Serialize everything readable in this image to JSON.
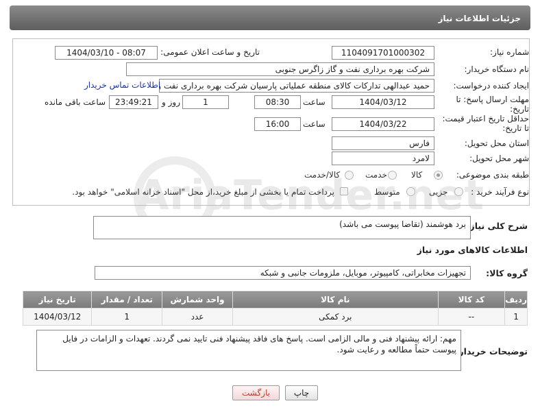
{
  "header": {
    "title": "جزئیات اطلاعات نیاز"
  },
  "watermark": {
    "text": "AriaTender.net"
  },
  "form": {
    "need_number_label": "شماره نیاز:",
    "need_number": "1104091701000302",
    "announce_label": "تاریخ و ساعت اعلان عمومی:",
    "announce_value": "1404/03/10 - 08:07",
    "buyer_org_label": "نام دستگاه خریدار:",
    "buyer_org": "شرکت بهره برداری نفت و گاز زاگرس جنوبی",
    "creator_label": "ایجاد کننده درخواست:",
    "creator": "حمید عبدالهی تدارکات کالای منطقه عملیاتی پارسیان شرکت بهره برداری نفت و",
    "contact_link": "اطلاعات تماس خریدار",
    "deadline_label_1": "مهلت ارسال پاسخ: تا",
    "deadline_label_2": "تاریخ:",
    "deadline_date": "1404/03/12",
    "time_label": "ساعت",
    "deadline_time": "08:30",
    "days_value": "1",
    "days_label": "روز و",
    "remaining_time": "23:49:21",
    "remaining_label": "ساعت باقی مانده",
    "validity_label_1": "حداقل تاریخ اعتبار قیمت:",
    "validity_label_2": "تا تاریخ:",
    "validity_date": "1404/03/22",
    "validity_time": "16:00",
    "province_label": "استان محل تحویل:",
    "province": "فارس",
    "city_label": "شهر محل تحویل:",
    "city": "لامرد",
    "category_label": "طبقه بندی موضوعی:",
    "category_options": [
      "کالا",
      "خدمت",
      "کالا/خدمت"
    ],
    "category_selected": "کالا",
    "purchase_type_label": "نوع فرآیند خرید :",
    "purchase_options": [
      "جزیی",
      "متوسط"
    ],
    "purchase_note": "پرداخت تمام یا بخشی از مبلغ خرید،از محل \"اسناد خزانه اسلامی\" خواهد بود."
  },
  "description": {
    "label": "شرح کلی نیاز:",
    "text": "برد هوشمند (تقاضا پیوست می باشد)"
  },
  "goods": {
    "section_title": "اطلاعات کالاهای مورد نیاز",
    "group_label": "گروه کالا:",
    "group_value": "تجهیزات مخابراتی، کامپیوتر، موبایل، ملزومات جانبی و شبکه",
    "columns": [
      "ردیف",
      "کد کالا",
      "نام کالا",
      "واحد شمارش",
      "تعداد / مقدار",
      "تاریخ نیاز"
    ],
    "rows": [
      [
        "1",
        "--",
        "برد کمکی",
        "عدد",
        "1",
        "1404/03/12"
      ]
    ]
  },
  "buyer_notes": {
    "label": "توضیحات خریدار:",
    "text": "مهم: ارائه پیشنهاد فنی و مالی الزامی است. پاسخ های فاقد پیشنهاد فنی تایید نمی گردند. تعهدات و الزامات در فایل پیوست حتماً مطالعه و رعایت شود."
  },
  "buttons": {
    "print": "چاپ",
    "back": "بازگشت"
  },
  "colors": {
    "header": "#6e6e6e",
    "link": "#1a33b0",
    "back_button_text": "#c0392b"
  }
}
